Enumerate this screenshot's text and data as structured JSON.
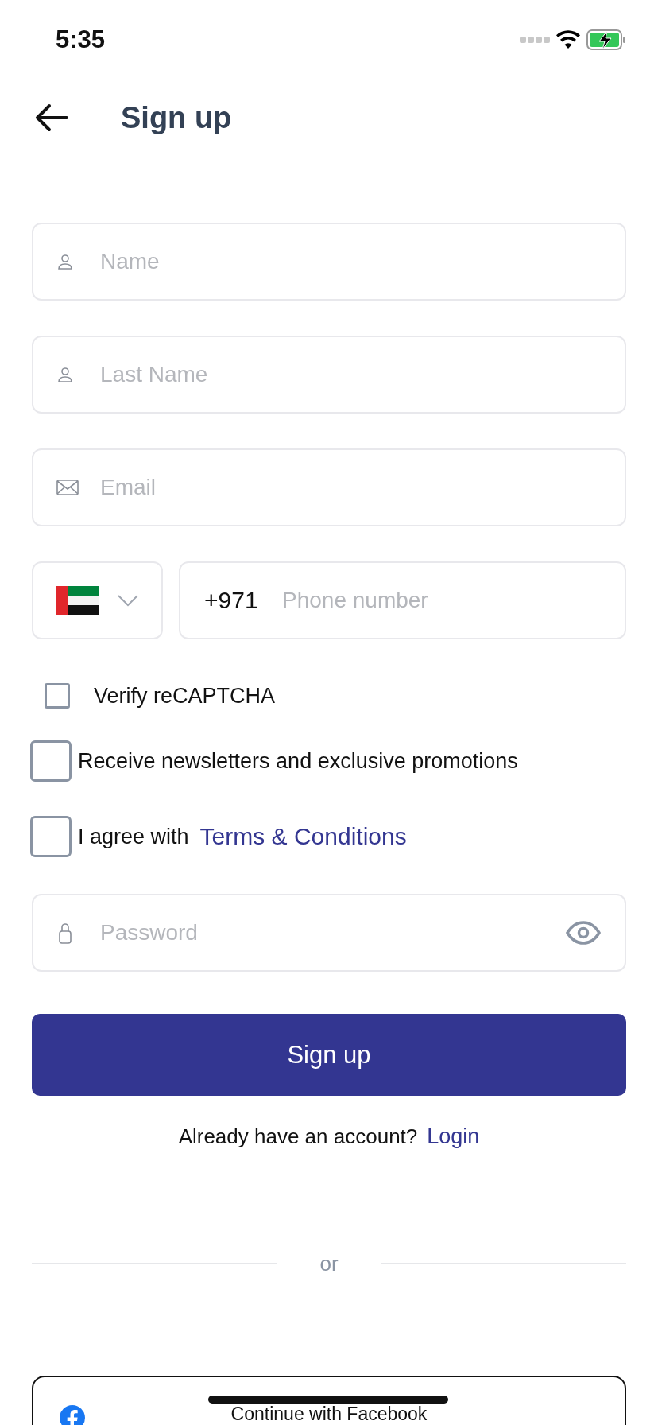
{
  "status_bar": {
    "time": "5:35"
  },
  "header": {
    "title": "Sign up"
  },
  "fields": [
    {
      "kind": "person",
      "placeholder": "Name"
    },
    {
      "kind": "person",
      "placeholder": "Last Name"
    },
    {
      "kind": "email",
      "placeholder": "Email"
    }
  ],
  "phone": {
    "country_code": "+971",
    "placeholder": "Phone number"
  },
  "checkboxes": [
    {
      "kind": "small",
      "label": "Verify reCAPTCHA",
      "checked": false
    },
    {
      "kind": "large",
      "label": "Receive newsletters and exclusive promotions",
      "checked": false
    },
    {
      "kind": "large",
      "label": "I agree with",
      "link": "Terms & Conditions",
      "checked": false
    }
  ],
  "password_field": {
    "placeholder": "Password"
  },
  "submit_button": {
    "label": "Sign up"
  },
  "login_prompt": {
    "text": "Already have an account?",
    "link": "Login"
  },
  "divider": {
    "label": "or"
  },
  "social_buttons": [
    {
      "kind": "facebook",
      "label": "Continue with Facebook"
    }
  ]
}
